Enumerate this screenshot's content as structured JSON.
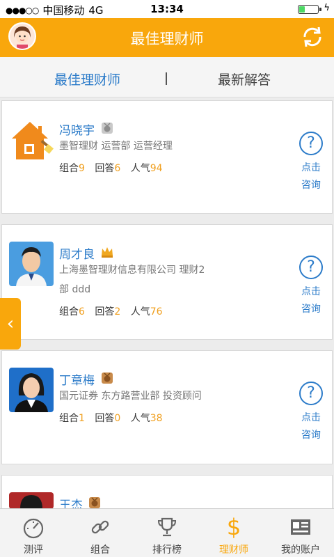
{
  "status": {
    "carrier": "中国移动",
    "network": "4G",
    "time": "13:34",
    "battery_level": 0.3
  },
  "header": {
    "title": "最佳理财师"
  },
  "tabs": [
    {
      "label": "最佳理财师"
    },
    {
      "label": "最新解答"
    }
  ],
  "advisors": [
    {
      "name": "冯晓宇",
      "org_line1": "墨智理财   运营部   运营经理",
      "org_line2": "",
      "stats": {
        "groups_label": "组合",
        "groups": "9",
        "answers_label": "回答",
        "answers": "6",
        "popularity_label": "人气",
        "popularity": "94"
      },
      "badge": "silver-medal-icon"
    },
    {
      "name": "周才良",
      "org_line1": "上海墨智理财信息有限公司   理财2",
      "org_line2": "部   ddd",
      "stats": {
        "groups_label": "组合",
        "groups": "6",
        "answers_label": "回答",
        "answers": "2",
        "popularity_label": "人气",
        "popularity": "76"
      },
      "badge": "crown-icon"
    },
    {
      "name": "丁章梅",
      "org_line1": "国元证券   东方路营业部   投资顾问",
      "org_line2": "",
      "stats": {
        "groups_label": "组合",
        "groups": "1",
        "answers_label": "回答",
        "answers": "0",
        "popularity_label": "人气",
        "popularity": "38"
      },
      "badge": "bronze-medal-icon"
    },
    {
      "name": "王杰",
      "org_line1": "",
      "org_line2": "",
      "badge": "bronze-medal-icon"
    }
  ],
  "ask": {
    "line1": "点击",
    "line2": "咨询"
  },
  "tabbar": [
    {
      "label": "测评",
      "icon": "gauge-icon"
    },
    {
      "label": "组合",
      "icon": "link-icon"
    },
    {
      "label": "排行榜",
      "icon": "trophy-icon"
    },
    {
      "label": "理财师",
      "icon": "dollar-icon",
      "active": true
    },
    {
      "label": "我的账户",
      "icon": "account-card-icon"
    }
  ],
  "colors": {
    "accent": "#f9a70c",
    "link": "#2b7bc9",
    "number": "#f0a020"
  }
}
